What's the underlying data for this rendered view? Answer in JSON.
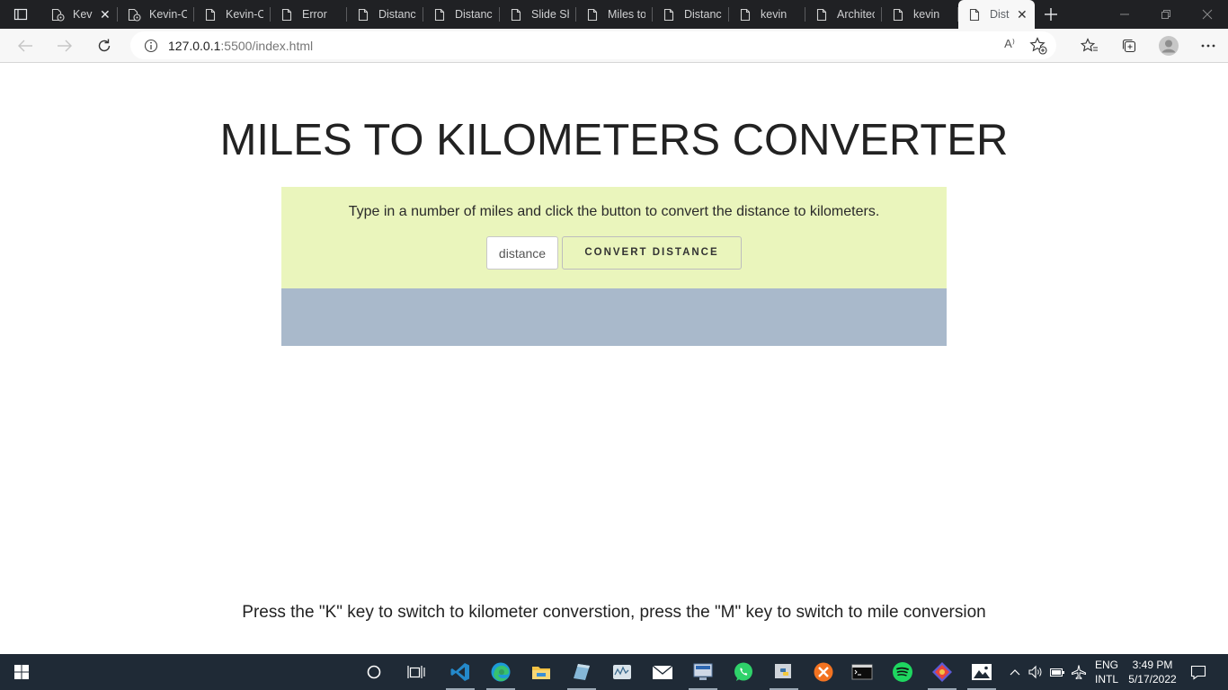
{
  "browser": {
    "tabs": [
      {
        "label": "Kev",
        "icon": "tab-extension-icon",
        "close": "✕"
      },
      {
        "label": "Kevin-Ch",
        "icon": "tab-extension-icon"
      },
      {
        "label": "Kevin-Ch",
        "icon": "page-icon"
      },
      {
        "label": "Error",
        "icon": "page-icon"
      },
      {
        "label": "Distance",
        "icon": "page-icon"
      },
      {
        "label": "Distance",
        "icon": "page-icon"
      },
      {
        "label": "Slide Sho",
        "icon": "page-icon"
      },
      {
        "label": "Miles to",
        "icon": "page-icon"
      },
      {
        "label": "Distance",
        "icon": "page-icon"
      },
      {
        "label": "kevin",
        "icon": "page-icon"
      },
      {
        "label": "Architect",
        "icon": "page-icon"
      },
      {
        "label": "kevin",
        "icon": "page-icon"
      },
      {
        "label": "Dist",
        "icon": "page-icon",
        "close": "✕",
        "active": true
      }
    ],
    "address": {
      "host": "127.0.0.1",
      "rest": ":5500/index.html"
    },
    "read_aloud_glyph": "A⁾"
  },
  "page": {
    "title": "MILES TO KILOMETERS CONVERTER",
    "instructions": "Type in a number of miles and click the button to convert the distance to kilometers.",
    "input_placeholder": "distance",
    "button_label": "CONVERT DISTANCE",
    "footer": "Press the \"K\" key to switch to kilometer converstion, press the \"M\" key to switch to mile conversion",
    "colors": {
      "panel": "#eaf5bc",
      "result": "#a9b9cb"
    }
  },
  "taskbar": {
    "language": {
      "line1": "ENG",
      "line2": "INTL"
    },
    "clock": {
      "time": "3:49 PM",
      "date": "5/17/2022"
    }
  }
}
